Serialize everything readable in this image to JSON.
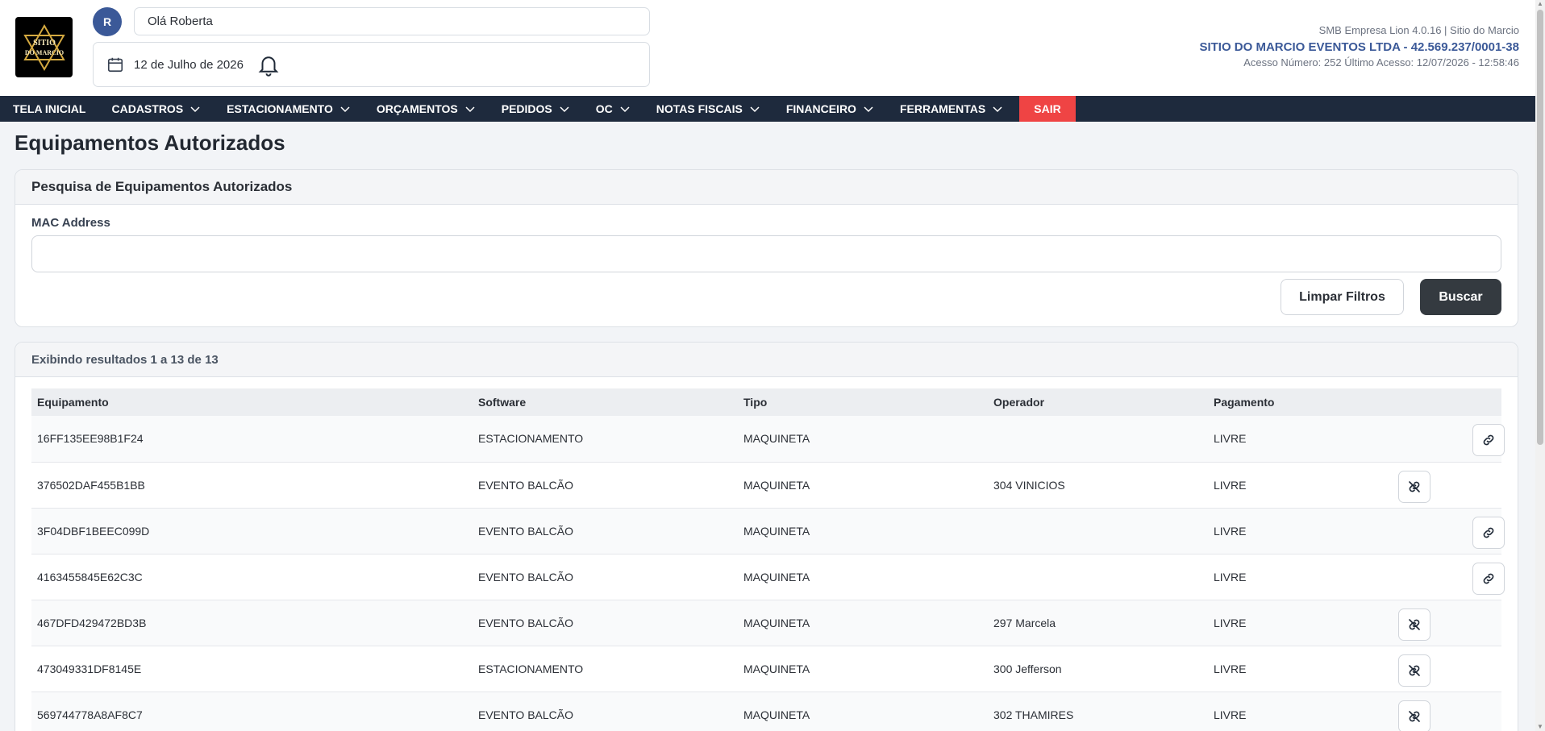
{
  "header": {
    "avatar_initial": "R",
    "greeting": "Olá Roberta",
    "date": "12 de Julho de 2026",
    "system_info": "SMB Empresa Lion 4.0.16 | Sitio do Marcio",
    "company": "SITIO DO MARCIO EVENTOS LTDA - 42.569.237/0001-38",
    "access_info": "Acesso Número: 252 Último Acesso: 12/07/2026 - 12:58:46",
    "logo_text_1": "SITIO",
    "logo_text_2": "DO MARCIO"
  },
  "nav": {
    "items": [
      {
        "label": "TELA INICIAL",
        "dropdown": false
      },
      {
        "label": "CADASTROS",
        "dropdown": true
      },
      {
        "label": "ESTACIONAMENTO",
        "dropdown": true
      },
      {
        "label": "ORÇAMENTOS",
        "dropdown": true
      },
      {
        "label": "PEDIDOS",
        "dropdown": true
      },
      {
        "label": "OC",
        "dropdown": true
      },
      {
        "label": "NOTAS FISCAIS",
        "dropdown": true
      },
      {
        "label": "FINANCEIRO",
        "dropdown": true
      },
      {
        "label": "FERRAMENTAS",
        "dropdown": true
      }
    ],
    "exit_label": "SAIR"
  },
  "page": {
    "title": "Equipamentos Autorizados"
  },
  "search": {
    "header": "Pesquisa de Equipamentos Autorizados",
    "mac_label": "MAC Address",
    "mac_value": "",
    "clear_label": "Limpar Filtros",
    "search_label": "Buscar"
  },
  "results": {
    "summary": "Exibindo resultados 1 a 13 de 13",
    "columns": [
      "Equipamento",
      "Software",
      "Tipo",
      "Operador",
      "Pagamento",
      ""
    ],
    "rows": [
      {
        "equipamento": "16FF135EE98B1F24",
        "software": "ESTACIONAMENTO",
        "tipo": "MAQUINETA",
        "operador": "",
        "pagamento": "LIVRE",
        "action": "link"
      },
      {
        "equipamento": "376502DAF455B1BB",
        "software": "EVENTO BALCÃO",
        "tipo": "MAQUINETA",
        "operador": "304 VINICIOS",
        "pagamento": "LIVRE",
        "action": "unlink"
      },
      {
        "equipamento": "3F04DBF1BEEC099D",
        "software": "EVENTO BALCÃO",
        "tipo": "MAQUINETA",
        "operador": "",
        "pagamento": "LIVRE",
        "action": "link"
      },
      {
        "equipamento": "4163455845E62C3C",
        "software": "EVENTO BALCÃO",
        "tipo": "MAQUINETA",
        "operador": "",
        "pagamento": "LIVRE",
        "action": "link"
      },
      {
        "equipamento": "467DFD429472BD3B",
        "software": "EVENTO BALCÃO",
        "tipo": "MAQUINETA",
        "operador": "297 Marcela",
        "pagamento": "LIVRE",
        "action": "unlink"
      },
      {
        "equipamento": "473049331DF8145E",
        "software": "ESTACIONAMENTO",
        "tipo": "MAQUINETA",
        "operador": "300 Jefferson",
        "pagamento": "LIVRE",
        "action": "unlink"
      },
      {
        "equipamento": "569744778A8AF8C7",
        "software": "EVENTO BALCÃO",
        "tipo": "MAQUINETA",
        "operador": "302 THAMIRES",
        "pagamento": "LIVRE",
        "action": "unlink"
      }
    ]
  },
  "colors": {
    "nav_bg": "#1e2a3d",
    "exit_bg": "#ef4444",
    "brand_blue": "#3b5998",
    "search_btn_bg": "#343a40"
  }
}
